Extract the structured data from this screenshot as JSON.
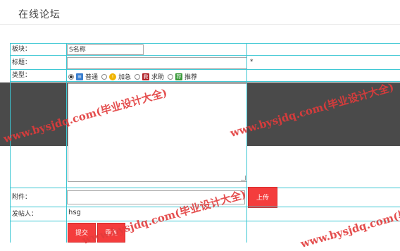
{
  "page": {
    "title": "在线论坛"
  },
  "form": {
    "board": {
      "label": "板块：",
      "value": "S名称"
    },
    "title": {
      "label": "标题：",
      "value": "",
      "required_mark": "*"
    },
    "type": {
      "label": "类型：",
      "options": [
        {
          "label": "普通",
          "icon": "blue-post-icon",
          "checked": true
        },
        {
          "label": "加急",
          "icon": "yellow-urgent-icon",
          "checked": false
        },
        {
          "label": "求助",
          "icon": "red-help-icon",
          "checked": false
        },
        {
          "label": "推荐",
          "icon": "green-recommend-icon",
          "checked": false
        }
      ]
    },
    "content": {
      "value": ""
    },
    "attachment": {
      "label": "附件：",
      "value": "",
      "upload_label": "上传"
    },
    "poster": {
      "label": "发帖人：",
      "value": "hsg"
    },
    "actions": {
      "submit_label": "提交",
      "reset_label": "重置"
    }
  },
  "watermark": {
    "text": "www.bysjdq.com(毕业设计大全)"
  },
  "colors": {
    "accent": "#f43d3d",
    "grid": "#3cc7d3",
    "band": "#4a4a4a"
  }
}
